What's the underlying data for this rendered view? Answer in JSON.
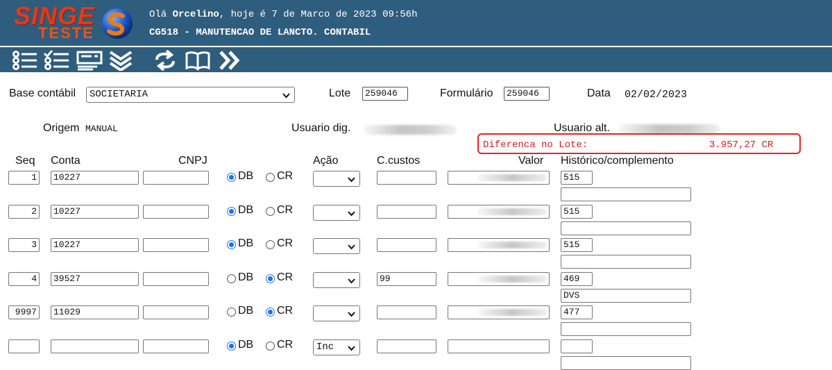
{
  "header": {
    "logo_main": "SINGE",
    "logo_sub": "TESTE",
    "greeting_prefix": "Olá ",
    "user_name": "Orcelino",
    "greeting_suffix": ", hoje é 7 de Marco de 2023 09:56h",
    "program_title": "CG518 - MANUTENCAO DE LANCTO. CONTABIL",
    "colors": {
      "bar": "#2f5d7d",
      "logo_red": "#e23a1c",
      "logo_orange": "#e8541a"
    }
  },
  "toolbar": {
    "icons": [
      "list-numbered-icon",
      "checklist-icon",
      "form-card-icon",
      "double-chevron-down-icon",
      "refresh-arrows-icon",
      "open-book-icon",
      "double-chevron-right-icon"
    ]
  },
  "form": {
    "base_label": "Base contábil",
    "base_value": "SOCIETARIA",
    "lote_label": "Lote",
    "lote_value": "259046",
    "formulario_label": "Formulário",
    "formulario_value": "259046",
    "data_label": "Data",
    "data_value": "02/02/2023",
    "origem_label": "Origem",
    "origem_value": "MANUAL",
    "usuario_dig_label": "Usuario dig.",
    "usuario_alt_label": "Usuario alt."
  },
  "diferenca": {
    "label": "Diferenca no Lote:",
    "value": "3.957,27 CR",
    "color": "#d32020"
  },
  "columns": {
    "seq": "Seq",
    "conta": "Conta",
    "cnpj": "CNPJ",
    "acao": "Ação",
    "ccustos": "C.custos",
    "valor": "Valor",
    "historico": "Histórico/complemento"
  },
  "radio_labels": {
    "db": "DB",
    "cr": "CR"
  },
  "rows": [
    {
      "seq": "1",
      "conta": "10227",
      "cnpj": "",
      "debit": true,
      "acao": "",
      "ccustos": "",
      "historico": "515",
      "complemento": ""
    },
    {
      "seq": "2",
      "conta": "10227",
      "cnpj": "",
      "debit": true,
      "acao": "",
      "ccustos": "",
      "historico": "515",
      "complemento": ""
    },
    {
      "seq": "3",
      "conta": "10227",
      "cnpj": "",
      "debit": true,
      "acao": "",
      "ccustos": "",
      "historico": "515",
      "complemento": ""
    },
    {
      "seq": "4",
      "conta": "39527",
      "cnpj": "",
      "debit": false,
      "acao": "",
      "ccustos": "99",
      "historico": "469",
      "complemento": "DVS"
    },
    {
      "seq": "9997",
      "conta": "11029",
      "cnpj": "",
      "debit": false,
      "acao": "",
      "ccustos": "",
      "historico": "477",
      "complemento": ""
    },
    {
      "seq": "",
      "conta": "",
      "cnpj": "",
      "debit": true,
      "acao": "Inc",
      "ccustos": "",
      "historico": "",
      "complemento": ""
    }
  ]
}
